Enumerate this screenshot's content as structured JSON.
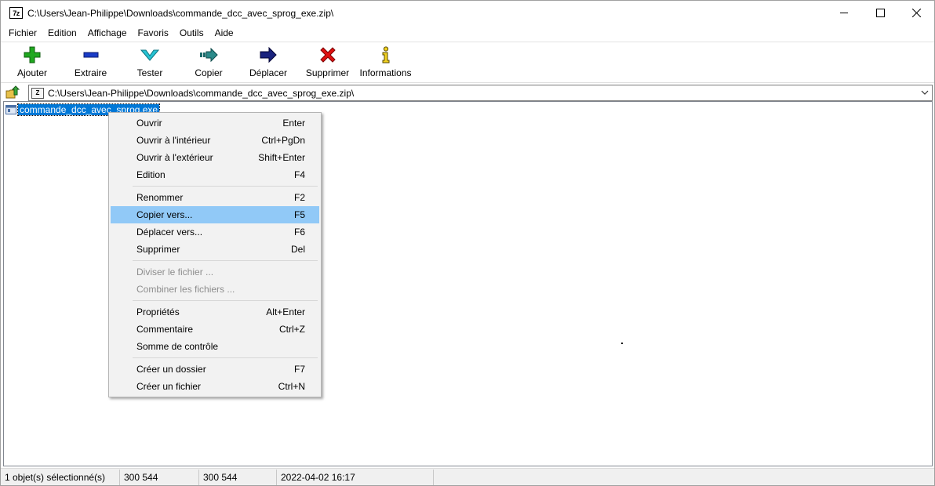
{
  "window": {
    "app_icon_text": "7z",
    "title": "C:\\Users\\Jean-Philippe\\Downloads\\commande_dcc_avec_sprog_exe.zip\\"
  },
  "menu": [
    {
      "label": "Fichier"
    },
    {
      "label": "Edition"
    },
    {
      "label": "Affichage"
    },
    {
      "label": "Favoris"
    },
    {
      "label": "Outils"
    },
    {
      "label": "Aide"
    }
  ],
  "toolbar": {
    "buttons": [
      {
        "label": "Ajouter",
        "icon": "plus-icon",
        "color": "#1fa81f"
      },
      {
        "label": "Extraire",
        "icon": "minus-icon",
        "color": "#1a3cc8"
      },
      {
        "label": "Tester",
        "icon": "check-chevron-icon",
        "color": "#27c3d3"
      },
      {
        "label": "Copier",
        "icon": "copy-arrow-icon",
        "color": "#2a8a8a"
      },
      {
        "label": "Déplacer",
        "icon": "move-arrow-icon",
        "color": "#1a237e"
      },
      {
        "label": "Supprimer",
        "icon": "delete-x-icon",
        "color": "#e01010"
      },
      {
        "label": "Informations",
        "icon": "info-icon",
        "color": "#f0d020"
      }
    ]
  },
  "address": {
    "path": "C:\\Users\\Jean-Philippe\\Downloads\\commande_dcc_avec_sprog_exe.zip\\",
    "zip_icon_text": "Z"
  },
  "files": [
    {
      "name": "commande_dcc_avec_sprog.exe",
      "selected": true
    }
  ],
  "context_menu": {
    "groups": [
      [
        {
          "label": "Ouvrir",
          "shortcut": "Enter"
        },
        {
          "label": "Ouvrir à l'intérieur",
          "shortcut": "Ctrl+PgDn"
        },
        {
          "label": "Ouvrir à l'extérieur",
          "shortcut": "Shift+Enter"
        },
        {
          "label": "Edition",
          "shortcut": "F4"
        }
      ],
      [
        {
          "label": "Renommer",
          "shortcut": "F2"
        },
        {
          "label": "Copier vers...",
          "shortcut": "F5",
          "active": true
        },
        {
          "label": "Déplacer vers...",
          "shortcut": "F6"
        },
        {
          "label": "Supprimer",
          "shortcut": "Del"
        }
      ],
      [
        {
          "label": "Diviser le fichier ...",
          "shortcut": "",
          "disabled": true
        },
        {
          "label": "Combiner les fichiers ...",
          "shortcut": "",
          "disabled": true
        }
      ],
      [
        {
          "label": "Propriétés",
          "shortcut": "Alt+Enter"
        },
        {
          "label": "Commentaire",
          "shortcut": "Ctrl+Z"
        },
        {
          "label": "Somme de contrôle",
          "shortcut": ""
        }
      ],
      [
        {
          "label": "Créer un dossier",
          "shortcut": "F7"
        },
        {
          "label": "Créer un fichier",
          "shortcut": "Ctrl+N"
        }
      ]
    ],
    "highlight_color": "#91c9f7"
  },
  "status": {
    "selection": "1 objet(s) sélectionné(s)",
    "size": "300 544",
    "packed_size": "300 544",
    "modified": "2022-04-02 16:17"
  }
}
